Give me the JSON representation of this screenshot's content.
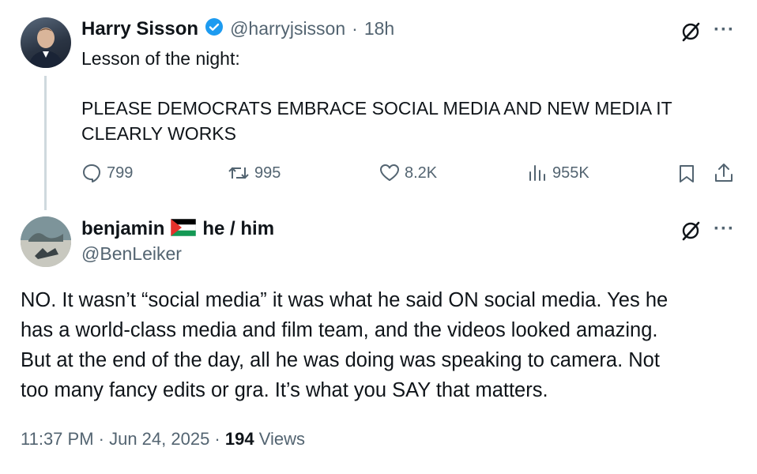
{
  "parent_tweet": {
    "author_name": "Harry Sisson",
    "handle": "@harryjsisson",
    "separator": "·",
    "time_ago": "18h",
    "text_line1": "Lesson of the night:",
    "text_line2": "PLEASE DEMOCRATS EMBRACE SOCIAL MEDIA AND NEW MEDIA IT",
    "text_line3": "CLEARLY WORKS",
    "replies": "799",
    "reposts": "995",
    "likes": "8.2K",
    "views": "955K",
    "verified": true
  },
  "reply_tweet": {
    "author_name": "benjamin",
    "pronouns": "he / him",
    "handle": "@BenLeiker",
    "text_line1": "NO. It wasn’t “social media” it was what he said ON social media. Yes he",
    "text_line2": "has a world-class media and film team, and the videos looked amazing.",
    "text_line3": "But at the end of the day, all he was doing was speaking to camera. Not",
    "text_line4": "too many fancy edits or gra. It’s what you SAY that matters.",
    "timestamp": "11:37 PM · Jun 24, 2025 ·",
    "views_count": "194",
    "views_label": "Views"
  },
  "colors": {
    "text": "#0f1419",
    "muted": "#536471",
    "verified_blue": "#1d9bf0",
    "thread_line": "#cfd9de"
  },
  "icons": [
    "grok-slash-icon",
    "more-icon",
    "reply-icon",
    "repost-icon",
    "like-icon",
    "views-icon",
    "bookmark-icon",
    "share-icon",
    "verified-badge-icon",
    "palestine-flag-icon"
  ]
}
